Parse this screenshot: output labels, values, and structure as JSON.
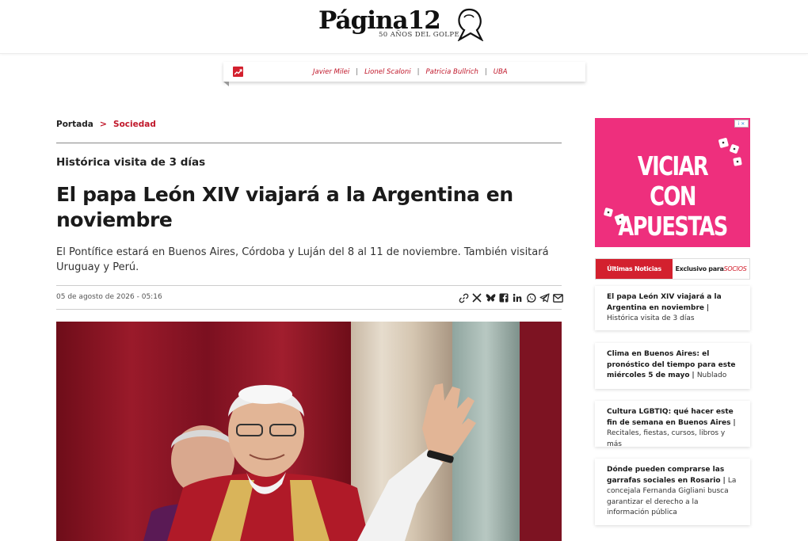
{
  "header": {
    "logo_text": "Página12",
    "logo_subtitle": "50 AÑOS DEL GOLPE"
  },
  "trending": {
    "icon": "trending-up-icon",
    "links": [
      "Javier Milei",
      "Lionel Scaloni",
      "Patricia Bullrich",
      "UBA"
    ]
  },
  "breadcrumb": {
    "home": "Portada",
    "separator": ">",
    "section": "Sociedad"
  },
  "article": {
    "kicker": "Histórica visita de 3 días",
    "headline": "El papa León XIV viajará a la Argentina en noviembre",
    "subhead": "El Pontífice estará en Buenos Aires, Córdoba y Luján del 8 al 11 de noviembre. También visitará Uruguay y Perú.",
    "date": "05 de agosto de 2026 - 05:16",
    "share_icons": [
      "link-icon",
      "x-icon",
      "bluesky-icon",
      "facebook-icon",
      "linkedin-icon",
      "whatsapp-icon",
      "telegram-icon",
      "email-icon"
    ]
  },
  "ad": {
    "text_line1": "VICIAR CON",
    "text_line2": "APUESTAS"
  },
  "sidebar": {
    "tab_active": "Últimas Noticias",
    "tab_other_prefix": "Exclusivo para",
    "tab_other_brand": "SOCIOS",
    "items": [
      {
        "title": "El papa León XIV viajará a la Argentina en noviembre",
        "summary": "Histórica visita de 3 días"
      },
      {
        "title": "Clima en Buenos Aires: el pronóstico del tiempo para este miércoles 5 de mayo",
        "summary": "Nublado"
      },
      {
        "title": "Cultura LGBTIQ: qué hacer este fin de semana en Buenos Aires",
        "summary": "Recitales, fiestas, cursos, libros y más"
      },
      {
        "title": "Dónde pueden comprarse las garrafas sociales en Rosario",
        "summary": "La concejala Fernanda Gigliani busca garantizar el derecho a la información pública"
      }
    ]
  },
  "colors": {
    "brand_red": "#d3202e",
    "ad_pink": "#ee2f7d"
  }
}
